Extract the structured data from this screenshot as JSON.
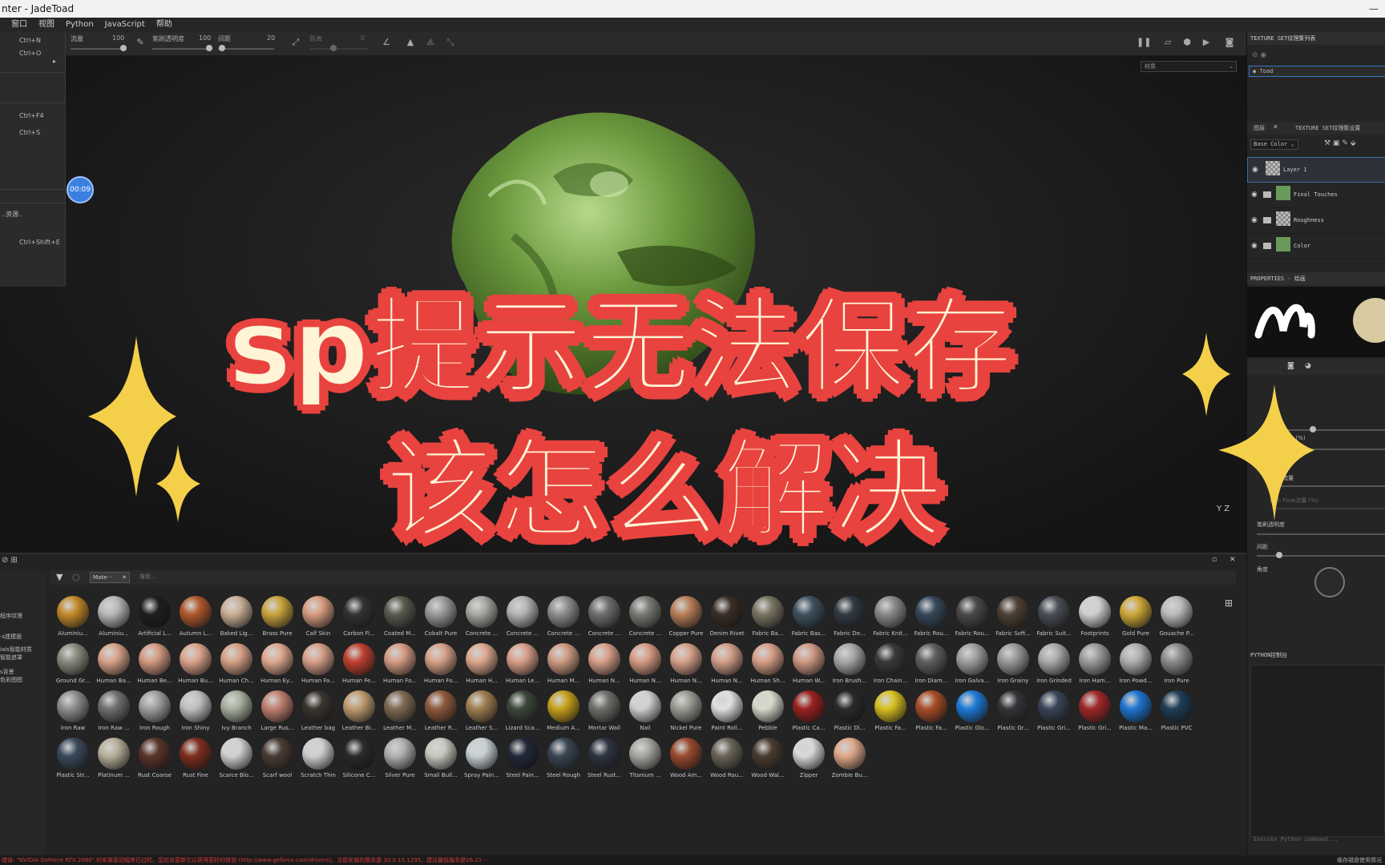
{
  "window": {
    "title": "nter - JadeToad"
  },
  "menu": [
    "窗口",
    "视图",
    "Python",
    "JavaScript",
    "帮助"
  ],
  "toolbar": {
    "flow_label": "流量",
    "flow_value": "100",
    "opacity_label": "笔刷透明度",
    "opacity_value": "100",
    "spacing_label": "间距",
    "spacing_value": "20",
    "angle_label": "距离",
    "angle_value": "0"
  },
  "file_menu": {
    "shortcuts": [
      "Ctrl+N",
      "Ctrl+O",
      "Ctrl+F4",
      "Ctrl+S",
      "Ctrl+Shift+E"
    ],
    "partial_item": "..资源.."
  },
  "viewport": {
    "material_mode": "材质",
    "timer": "00:09",
    "axes": "Y Z"
  },
  "overlay": {
    "line1": "sp提示无法保存",
    "line2": "该怎么解决"
  },
  "right_panel": {
    "texture_set_list_title": "TEXTURE SET纹理集列表",
    "texture_set_item": "Toad",
    "layers_tab": "图层",
    "settings_tab": "TEXTURE SET纹理集设置",
    "channel": "Base Color",
    "layers": [
      "Layer 1",
      "Final Touches",
      "Roughness",
      "Color"
    ],
    "properties_title": "PROPERTIES - 绘画",
    "size_label": "最小 大小 (%)",
    "flow_label": "Flow流量",
    "flow_sub": "Flow流量",
    "min_flow_label": "最小 Flow流量 (%)",
    "opacity_label": "笔刷透明度",
    "spacing_label": "间距",
    "angle_label": "角度",
    "python_console_title": "PYTHON控制台",
    "python_placeholder": "Execute Python command..."
  },
  "shelf": {
    "filter_chip": "Mate···",
    "search_placeholder": "搜索...",
    "left_items": [
      "程序纹理",
      "-s建模面",
      "ials智能材质",
      "智能遮罩",
      "s背景",
      "色彩图图"
    ],
    "materials": [
      [
        "Aluminiu...",
        "Aluminiu...",
        "Artificial L...",
        "Autumn L...",
        "Baked Lig...",
        "Brass Pure",
        "Calf Skin",
        "Carbon Fi...",
        "Coated M...",
        "Cobalt Pure",
        "Concrete ...",
        "Concrete ...",
        "Concrete ...",
        "Concrete ...",
        "Concrete ...",
        "Copper Pure",
        "Denim Rivet",
        "Fabric Ba...",
        "Fabric Bas...",
        "Fabric De...",
        "Fabric Knit...",
        "Fabric Rou...",
        "Fabric Rou...",
        "Fabric Soft...",
        "Fabric Suit...",
        "Footprints",
        "Gold Pure",
        "Gouache P..."
      ],
      [
        "Ground Gr...",
        "Human Ba...",
        "Human Be...",
        "Human Bu...",
        "Human Ch...",
        "Human Ey...",
        "Human Fa...",
        "Human Fe...",
        "Human Fo...",
        "Human Fo...",
        "Human H...",
        "Human Le...",
        "Human M...",
        "Human N...",
        "Human N...",
        "Human N...",
        "Human N...",
        "Human Sh...",
        "Human W...",
        "Iron Brush...",
        "Iron Chain...",
        "Iron Diam...",
        "Iron Galva...",
        "Iron Grainy",
        "Iron Grinded",
        "Iron Ham...",
        "Iron Powd...",
        "Iron Pure"
      ],
      [
        "Iron Raw",
        "Iron Raw ...",
        "Iron Rough",
        "Iron Shiny",
        "Ivy Branch",
        "Large Rus...",
        "Leather bag",
        "Leather Bi...",
        "Leather M...",
        "Leather R...",
        "Leather S...",
        "Lizard Sca...",
        "Medium A...",
        "Mortar Wall",
        "Nail",
        "Nickel Pure",
        "Paint Roll...",
        "Pebble",
        "Plastic Ca...",
        "Plastic Di...",
        "Plastic Fa...",
        "Plastic Fa...",
        "Plastic Glo...",
        "Plastic Gr...",
        "Plastic Gri...",
        "Plastic Gri...",
        "Plastic Ma...",
        "Plastic PVC"
      ],
      [
        "Plastic Str...",
        "Platinum ...",
        "Rust Coarse",
        "Rust Fine",
        "Scarce Blo...",
        "Scarf wool",
        "Scratch Thin",
        "Silicone C...",
        "Silver Pure",
        "Small Bull...",
        "Spray Pain...",
        "Steel Pain...",
        "Steel Rough",
        "Steel Rust...",
        "Titanium ...",
        "Wood Am...",
        "Wood Rou...",
        "Wood Wal...",
        "Zipper",
        "Zombie Bu..."
      ]
    ],
    "colors": [
      [
        "#c48a2a",
        "#b8b8b8",
        "#1e1e1e",
        "#b0582c",
        "#c9b096",
        "#c8a43c",
        "#d89c80",
        "#333333",
        "#5a5a4e",
        "#9a9a9a",
        "#a8a8a2",
        "#b4b4b4",
        "#8e8e8e",
        "#6e6e6e",
        "#7a7a74",
        "#b87e58",
        "#3a2e26",
        "#7a7462",
        "#3e5260",
        "#323a44",
        "#8a8a8a",
        "#36485a",
        "#4a4a4a",
        "#4e4034",
        "#4a4e56",
        "#d0d0d0",
        "#cfa838",
        "#bcbcbc"
      ],
      [
        "#8a8a7e",
        "#d8a48a",
        "#d49a80",
        "#dca48c",
        "#d6a286",
        "#e0aa90",
        "#d8a08a",
        "#c04030",
        "#d49c84",
        "#d8a28a",
        "#dea88e",
        "#d8a08a",
        "#d09c84",
        "#d8a08a",
        "#d89c84",
        "#d8a28c",
        "#d4a08a",
        "#d8a08a",
        "#d09a84",
        "#a8a8a8",
        "#3a3a3a",
        "#606060",
        "#a0a0a0",
        "#9a9a9a",
        "#aaaaaa",
        "#9c9c9c",
        "#b0b0b0",
        "#8c8c8c"
      ],
      [
        "#8e8e8e",
        "#707070",
        "#a0a0a0",
        "#c0c0c0",
        "#a8b0a0",
        "#c08070",
        "#3a342e",
        "#c09c70",
        "#7e6a54",
        "#8e5a3c",
        "#a07e50",
        "#3c463a",
        "#c8a01c",
        "#6e6e6a",
        "#d0d0d0",
        "#9c9c94",
        "#e0e0e0",
        "#d8d8cc",
        "#9a2020",
        "#2a2a2a",
        "#d8c020",
        "#a84e28",
        "#1e7ad8",
        "#333538",
        "#3a4458",
        "#a02828",
        "#1e74d0",
        "#1e3e58"
      ],
      [
        "#3a4a5c",
        "#b8ae98",
        "#5a3428",
        "#7e2e1e",
        "#d0d0d0",
        "#4a3c34",
        "#d0d0d0",
        "#2a2a2a",
        "#b0b0b0",
        "#c8c8c0",
        "#c8d0d4",
        "#222838",
        "#3a4654",
        "#2e3440",
        "#a8a6a0",
        "#9a4a2e",
        "#6a6458",
        "#4a3c30",
        "#d8d8d8",
        "#e0a88a"
      ]
    ]
  },
  "status": {
    "error": "错误: \"NVIDIA GeForce RTX 2060\" 的安装驱动程序已过时。您应该更新它以获得更好的体验 (http://www.geforce.com/drivers)。当前安装的版本是 30.0.15.1295。建议最低版本是26.21···",
    "right": "缓存磁盘使用情况"
  }
}
